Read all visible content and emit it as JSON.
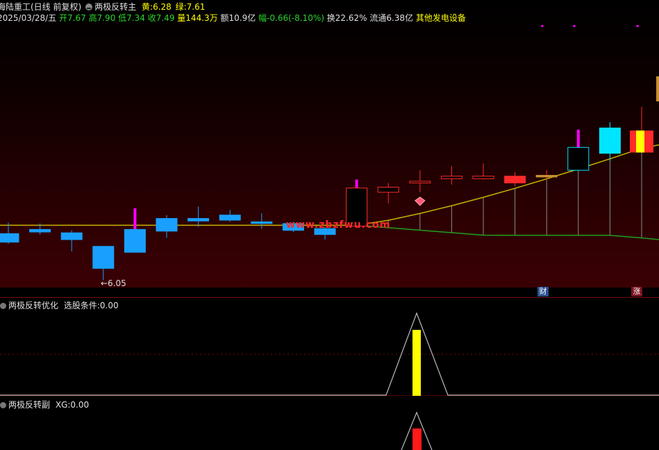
{
  "header": {
    "title": "海陆重工(日线 前复权)",
    "indicator_name": "两极反转主",
    "yellow_label": "黄:",
    "yellow_value": "6.28",
    "green_label": "绿:",
    "green_value": "7.61"
  },
  "quote": {
    "date": "2025/03/28/五",
    "open": "开7.67",
    "high": "高7.90",
    "low": "低7.34",
    "close": "收7.49",
    "volume": "量144.3万",
    "amount": "额10.9亿",
    "change": "幅-0.66(-8.10%)",
    "turnover": "换22.62%",
    "float_cap": "流通6.38亿",
    "sector": "其他发电设备"
  },
  "chart": {
    "min_price_label": "←6.05",
    "watermark": "www.zbzfwu.com",
    "badge_finance": "财",
    "badge_rise": "涨"
  },
  "panel2": {
    "name": "两极反转优化",
    "field": "选股条件:",
    "value": "0.00"
  },
  "panel3": {
    "name": "两极反转副",
    "field": "XG:",
    "value": "0.00"
  },
  "colors": {
    "up": "#ff2a2a",
    "down": "#19a0ff",
    "yellow": "#ffff00",
    "green": "#2bd42b",
    "magenta": "#ff00ff"
  },
  "chart_data": {
    "type": "candlestick",
    "candles": [
      {
        "o": 6.6,
        "c": 6.5,
        "h": 6.73,
        "l": 6.48
      },
      {
        "o": 6.65,
        "c": 6.62,
        "h": 6.72,
        "l": 6.59
      },
      {
        "o": 6.61,
        "c": 6.53,
        "h": 6.64,
        "l": 6.39
      },
      {
        "o": 6.45,
        "c": 6.19,
        "h": 6.45,
        "l": 6.05
      },
      {
        "o": 6.65,
        "c": 6.38,
        "h": 6.9,
        "l": 6.38
      },
      {
        "o": 6.78,
        "c": 6.63,
        "h": 6.82,
        "l": 6.55
      },
      {
        "o": 6.78,
        "c": 6.75,
        "h": 6.92,
        "l": 6.68
      },
      {
        "o": 6.82,
        "c": 6.76,
        "h": 6.88,
        "l": 6.74
      },
      {
        "o": 6.74,
        "c": 6.72,
        "h": 6.84,
        "l": 6.66
      },
      {
        "o": 6.72,
        "c": 6.64,
        "h": 6.74,
        "l": 6.62
      },
      {
        "o": 6.66,
        "c": 6.59,
        "h": 6.68,
        "l": 6.53
      },
      {
        "o": 6.69,
        "c": 7.14,
        "h": 7.24,
        "l": 6.69
      },
      {
        "o": 7.15,
        "c": 7.09,
        "h": 7.2,
        "l": 6.96
      },
      {
        "o": 7.22,
        "c": 7.2,
        "h": 7.35,
        "l": 7.09
      },
      {
        "o": 7.28,
        "c": 7.25,
        "h": 7.4,
        "l": 7.18
      },
      {
        "o": 7.28,
        "c": 7.25,
        "h": 7.43,
        "l": 7.24
      },
      {
        "o": 7.28,
        "c": 7.2,
        "h": 7.33,
        "l": 7.16
      },
      {
        "o": 7.29,
        "c": 7.27,
        "h": 7.35,
        "l": 7.24
      },
      {
        "o": 7.35,
        "c": 7.62,
        "h": 7.83,
        "l": 7.35
      },
      {
        "o": 7.55,
        "c": 7.85,
        "h": 7.92,
        "l": 7.46
      },
      {
        "o": 7.82,
        "c": 7.56,
        "h": 8.1,
        "l": 7.56
      }
    ],
    "yellow_line": {
      "label": "黄",
      "start_index": 11,
      "start": 6.7,
      "end": 7.61
    },
    "green_line": {
      "label": "绿",
      "start": 6.7,
      "min": 6.58,
      "end": 6.55
    },
    "ref_line": 6.7,
    "signal_index": 13
  }
}
